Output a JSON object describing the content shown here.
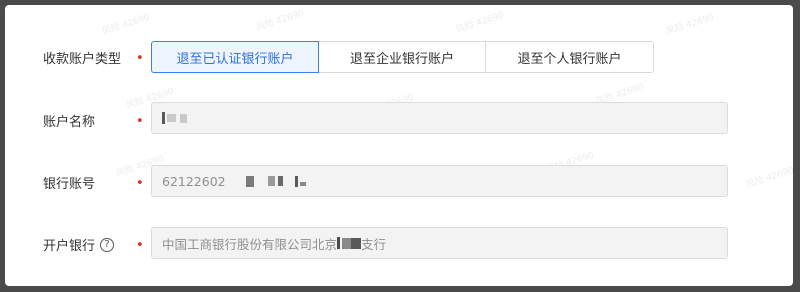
{
  "top_partial": "· ·",
  "watermark": "风险 42690",
  "form": {
    "account_type": {
      "label": "收款账户类型",
      "options": [
        "退至已认证银行账户",
        "退至企业银行账户",
        "退至个人银行账户"
      ],
      "selected_index": 0
    },
    "account_name": {
      "label": "账户名称",
      "value": ""
    },
    "bank_account": {
      "label": "银行账号",
      "value_prefix": "62122602"
    },
    "bank_branch": {
      "label": "开户银行",
      "help_glyph": "?",
      "value_prefix": "中国工商银行股份有限公司北京",
      "value_suffix": "支行"
    }
  },
  "required_mark": "•",
  "colors": {
    "accent": "#2f6fe0",
    "required": "#e0301e",
    "disabled_bg": "#f3f3f3"
  }
}
